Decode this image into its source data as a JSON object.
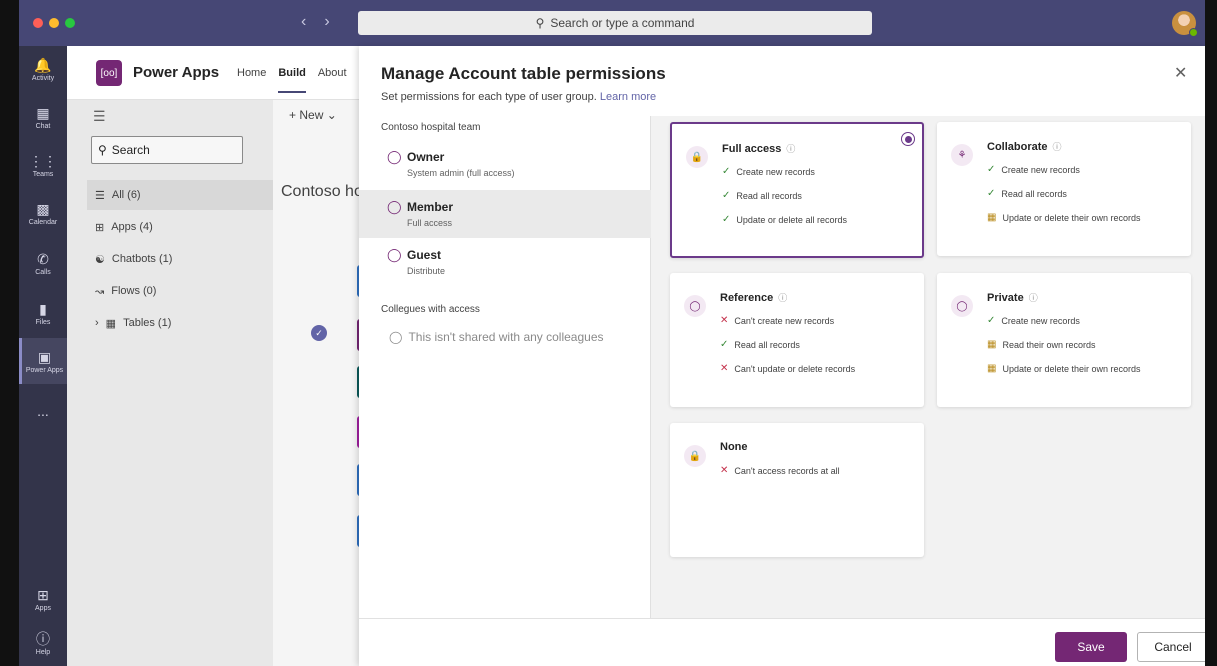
{
  "window": {
    "search_placeholder": "Search or type a command"
  },
  "rail": [
    {
      "label": "Activity",
      "icon": "bell-icon"
    },
    {
      "label": "Chat",
      "icon": "chat-icon"
    },
    {
      "label": "Teams",
      "icon": "teams-icon"
    },
    {
      "label": "Calendar",
      "icon": "calendar-icon"
    },
    {
      "label": "Calls",
      "icon": "phone-icon"
    },
    {
      "label": "Files",
      "icon": "file-icon"
    },
    {
      "label": "Power Apps",
      "icon": "power-apps-icon"
    },
    {
      "label": "...",
      "icon": "more-icon"
    },
    {
      "label": "Apps",
      "icon": "apps-icon"
    },
    {
      "label": "Help",
      "icon": "help-icon"
    }
  ],
  "header": {
    "app_title": "Power Apps",
    "logo_text": "[oo]",
    "nav": [
      "Home",
      "Build",
      "About"
    ]
  },
  "left_nav": {
    "search_label": "Search",
    "items": [
      {
        "label": "All (6)",
        "icon": "list-icon"
      },
      {
        "label": "Apps (4)",
        "icon": "grid-icon"
      },
      {
        "label": "Chatbots (1)",
        "icon": "bot-icon"
      },
      {
        "label": "Flows (0)",
        "icon": "flow-icon"
      },
      {
        "label": "Tables (1)",
        "icon": "table-icon"
      }
    ]
  },
  "middle": {
    "new_label": "New",
    "title": "Contoso ho"
  },
  "modal": {
    "title": "Manage Account table permissions",
    "subtitle": "Set permissions for each type of user group.",
    "learn_more": "Learn more",
    "team_section": "Contoso hospital team",
    "groups": [
      {
        "name": "Owner",
        "desc": "System admin (full access)"
      },
      {
        "name": "Member",
        "desc": "Full access"
      },
      {
        "name": "Guest",
        "desc": "Distribute"
      }
    ],
    "colleagues_section": "Collegues with access",
    "colleagues_empty": "This isn't shared with any colleagues",
    "cards": [
      {
        "name": "Full access",
        "rows": [
          {
            "status": "ok",
            "text": "Create new records"
          },
          {
            "status": "ok",
            "text": "Read all records"
          },
          {
            "status": "ok",
            "text": "Update or delete all records"
          }
        ]
      },
      {
        "name": "Collaborate",
        "rows": [
          {
            "status": "ok",
            "text": "Create new records"
          },
          {
            "status": "ok",
            "text": "Read all records"
          },
          {
            "status": "own",
            "text": "Update or delete their own records"
          }
        ]
      },
      {
        "name": "Reference",
        "rows": [
          {
            "status": "no",
            "text": "Can't create new records"
          },
          {
            "status": "ok",
            "text": "Read all records"
          },
          {
            "status": "no",
            "text": "Can't update or delete records"
          }
        ]
      },
      {
        "name": "Private",
        "rows": [
          {
            "status": "ok",
            "text": "Create new records"
          },
          {
            "status": "own",
            "text": "Read their own records"
          },
          {
            "status": "own",
            "text": "Update or delete their own records"
          }
        ]
      },
      {
        "name": "None",
        "rows": [
          {
            "status": "no",
            "text": "Can't access records at all"
          }
        ]
      }
    ],
    "save_label": "Save",
    "cancel_label": "Cancel"
  },
  "colors": {
    "accent": "#742774",
    "teams_bar": "#464775",
    "rail": "#33344a"
  }
}
